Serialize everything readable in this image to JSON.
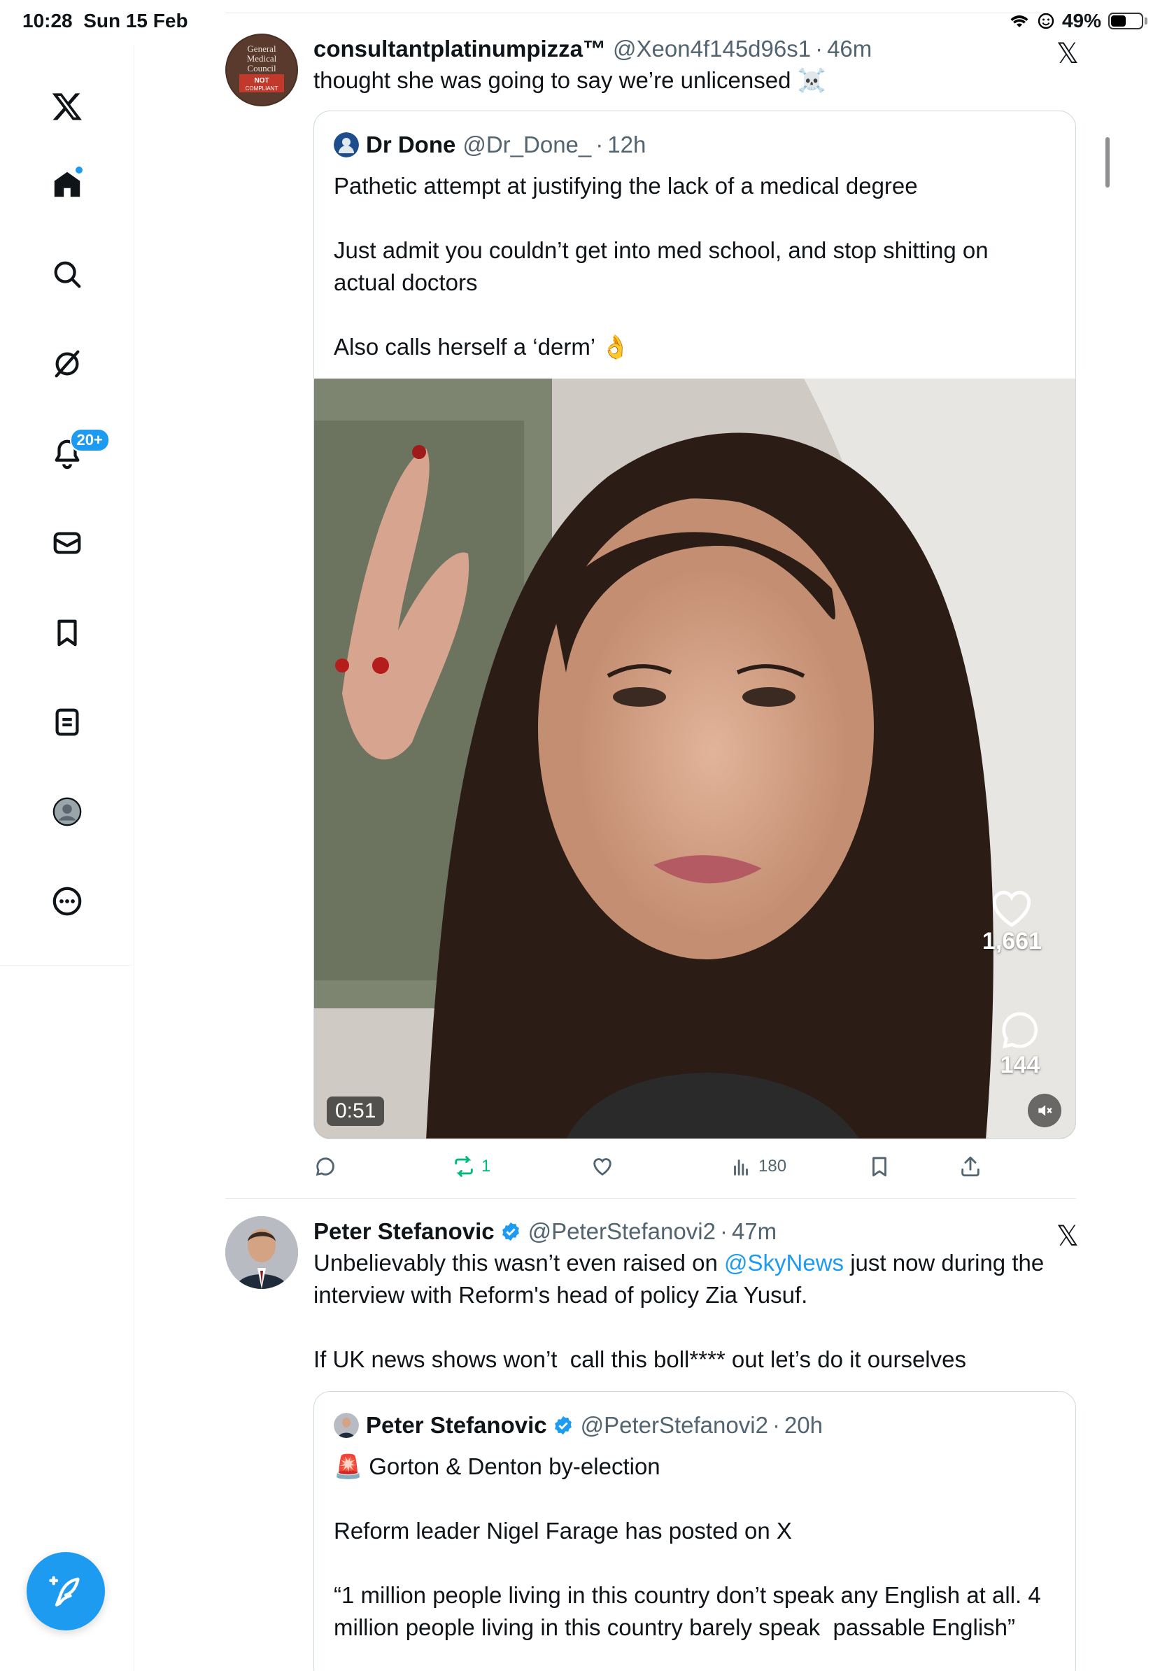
{
  "status_bar": {
    "time": "10:28",
    "date": "Sun 15 Feb",
    "battery": "49%",
    "battery_level": 0.49
  },
  "sidebar": {
    "items": [
      {
        "name": "x-logo",
        "icon": "x-logo-icon"
      },
      {
        "name": "home",
        "icon": "home-icon"
      },
      {
        "name": "search",
        "icon": "search-icon"
      },
      {
        "name": "grok",
        "icon": "grok-icon"
      },
      {
        "name": "notifications",
        "icon": "bell-icon",
        "badge": "20+"
      },
      {
        "name": "messages",
        "icon": "mail-icon"
      },
      {
        "name": "bookmarks",
        "icon": "bookmark-icon"
      },
      {
        "name": "lists",
        "icon": "list-icon"
      },
      {
        "name": "profile",
        "icon": "profile-icon"
      },
      {
        "name": "more",
        "icon": "more-icon"
      }
    ],
    "compose_icon": "compose-icon"
  },
  "posts": [
    {
      "author": "consultantplatinumpizza™",
      "handle": "@Xeon4f145d96s1",
      "time": "46m",
      "text": "thought she was going to say we’re unlicensed ☠️",
      "avatar_text": [
        "General",
        "Medical",
        "Council",
        "NOT",
        "COMPLIANT"
      ],
      "quote": {
        "author": "Dr Done",
        "handle": "@Dr_Done_",
        "time": "12h",
        "text": "Pathetic attempt at justifying the lack of a medical degree\n\nJust admit you couldn’t get into med school, and stop shitting on actual doctors\n\nAlso calls herself a ‘derm’ 👌",
        "video": {
          "duration": "0:51",
          "likes": "1,661",
          "comments": "144"
        }
      },
      "actions": {
        "reposts": "1",
        "views": "180"
      }
    },
    {
      "author": "Peter Stefanovic",
      "handle": "@PeterStefanovi2",
      "time": "47m",
      "text_before_link": "Unbelievably this wasn’t even raised on ",
      "link": "@SkyNews",
      "text_after_link": " just now during the interview with Reform's head of policy Zia Yusuf.\n\nIf UK news shows won’t  call this boll**** out let’s do it ourselves",
      "quote": {
        "author": "Peter Stefanovic",
        "handle": "@PeterStefanovi2",
        "time": "20h",
        "text": "🚨 Gorton & Denton by-election\n\nReform leader Nigel Farage has posted on X\n\n“1 million people living in this country don’t speak any English at all. 4 million people living in this country barely speak  passable English”"
      }
    }
  ],
  "colors": {
    "accent": "#1d9bf0",
    "repost_green": "#00ba7c",
    "text": "#0f1419",
    "muted": "#536471"
  }
}
